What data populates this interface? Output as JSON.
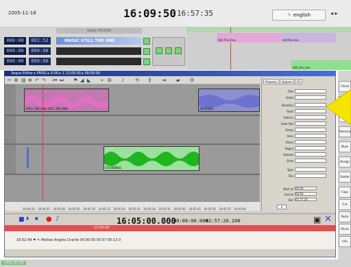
{
  "header": {
    "date": "2005-11-18",
    "clock_main": "16:09:50",
    "clock_secondary": "16:57:35",
    "language": "english",
    "arrows": "◂ ▸"
  },
  "mixer": {
    "deck_title": "Radio STUDIO",
    "rows": [
      {
        "tc1": "000:00",
        "tc2": "002:52",
        "label": "MUSIC STILL THE ONE"
      },
      {
        "tc1": "000:00",
        "tc2": "000:00",
        "label": ""
      },
      {
        "tc1": "000:00",
        "tc2": "000:00",
        "label": ""
      }
    ],
    "timeline_clips": [
      "Still The One",
      "still the one",
      "Still_the_one"
    ]
  },
  "editor": {
    "title": "Segue Editor  ▸  PROG ▸ 0:00 ▸ 1  12:05:00 ▸ 00:00:00",
    "tracks": [
      {
        "label": "STILL THE ONE  STILL THE ONE",
        "color": "#d670b7"
      },
      {
        "label": "INTERNAL",
        "color": "#7a7fd2"
      },
      {
        "label": "SOUNDBED",
        "color": "#3ec63e"
      }
    ],
    "ruler_ticks": [
      "16:04:50",
      "16:04:55",
      "16:05:00",
      "16:05:05",
      "16:05:10",
      "16:05:15",
      "16:05:20",
      "16:05:25",
      "16:05:30",
      "16:05:35",
      "16:05:40",
      "16:05:45",
      "16:05:50",
      "16:05:55",
      "16:05:60"
    ],
    "timecode_main": "16:05:00.000",
    "timecode_a": "00:00:00.000",
    "timecode_b": "02:57:20.200",
    "property_tabs": [
      "Property",
      "Options",
      "FX"
    ],
    "property_fields": [
      "Title",
      "Artist",
      "Duration",
      "Start",
      "Fade-In",
      "Fade-Out",
      "Ramp",
      "Intro",
      "Outro",
      "Segue",
      "Volume",
      "Ends",
      "Type",
      "File"
    ],
    "property_values": {
      "start_at": "00:00",
      "end_at": "00:00",
      "duration": "02:57.20"
    },
    "property_tail_labels": [
      "Start at",
      "End at",
      "Dur"
    ],
    "page_label": "0"
  },
  "list": {
    "red_row": "12:05:00",
    "row": "16:02:49   ⚑   ✎   Mellow                    Angela Charlie   00:00:00   00:57   00:13   0"
  },
  "status": {
    "text": "+001:33.00"
  },
  "right_panel": {
    "buttons": [
      "Check",
      "Edit",
      "Start",
      "Remove",
      "Mute",
      "Design",
      "Delete",
      "Copy",
      "Cut",
      "Paste",
      "Olives",
      "Info"
    ]
  },
  "colors": {
    "accent_blue": "#1a2f7a",
    "clip_pink": "#d670b7",
    "clip_violet": "#7a7fd2",
    "clip_green": "#3ec63e",
    "arrow_yellow": "#f6e400"
  }
}
